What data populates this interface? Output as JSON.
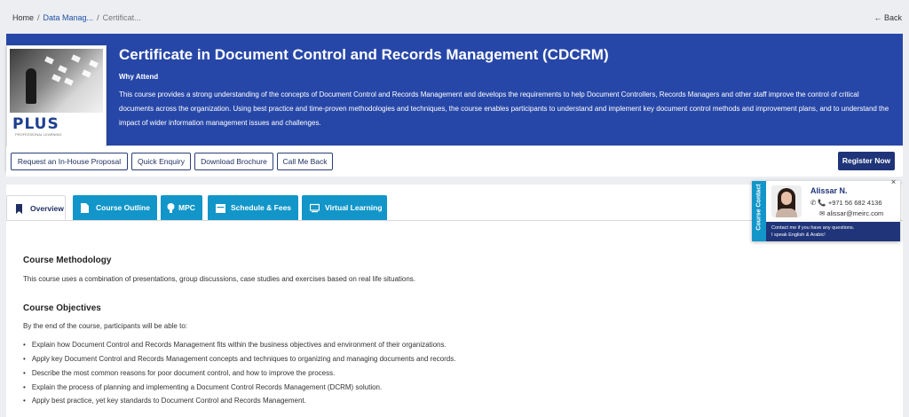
{
  "breadcrumb": {
    "home": "Home",
    "sep": "/",
    "category": "Data Manag...",
    "current": "Certificat...",
    "back": "Back"
  },
  "hero": {
    "title": "Certificate in Document Control and Records Management (CDCRM)",
    "why_attend": "Why Attend",
    "description": "This course provides a strong understanding of the concepts of Document Control and Records Management and develops the requirements to help Document Controllers, Records Managers and other staff improve the control of critical documents across the organization. Using best practice and time-proven methodologies and techniques, the course enables participants to understand and implement key document control methods and improvement plans, and to understand the impact of wider information management issues and challenges.",
    "logo_text": "PLUS",
    "logo_sub": "PROFESSIONAL LEARNING"
  },
  "actions": {
    "in_house": "Request an In-House Proposal",
    "quick_enquiry": "Quick Enquiry",
    "download_brochure": "Download Brochure",
    "call_me_back": "Call Me Back",
    "register": "Register Now"
  },
  "tabs": [
    {
      "label": "Overview",
      "icon": "bookmark-icon"
    },
    {
      "label": "Course Outline",
      "icon": "document-icon"
    },
    {
      "label": "MPC",
      "icon": "lightbulb-icon"
    },
    {
      "label": "Schedule & Fees",
      "icon": "calendar-icon"
    },
    {
      "label": "Virtual Learning",
      "icon": "monitor-icon"
    }
  ],
  "methodology": {
    "title": "Course Methodology",
    "text": "This course uses a combination of presentations, group discussions, case studies and exercises based on real life situations."
  },
  "objectives": {
    "title": "Course Objectives",
    "intro": "By the end of the course, participants will be able to:",
    "items": [
      "Explain how Document Control and Records Management fits within the business objectives and environment of their organizations.",
      "Apply key Document Control and Records Management concepts and techniques to organizing and managing documents and records.",
      "Describe the most common reasons for poor document control, and how to improve the process.",
      "Explain the process of planning and implementing a Document Control Records Management (DCRM) solution.",
      "Apply best practice, yet key standards to Document Control and Records Management."
    ]
  },
  "contact": {
    "tab_label": "Course Contact",
    "name": "Alissar N.",
    "phone": "+971 56 682 4136",
    "email": "alissar@meirc.com",
    "message_line1": "Contact me if you have any questions.",
    "message_line2": "I speak English & Arabic!",
    "close": "×"
  },
  "colors": {
    "hero_bg": "#2747a8",
    "tab_cyan": "#1296c9",
    "navy": "#1f3479"
  }
}
